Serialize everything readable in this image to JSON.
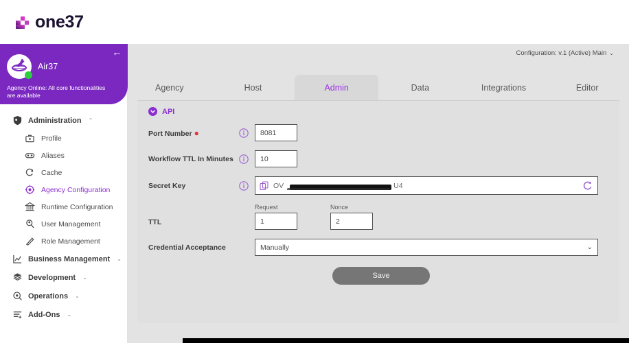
{
  "brand": {
    "name": "one37",
    "logo_icon": "one37-mark-icon"
  },
  "agency": {
    "name": "Air37",
    "status_text": "Agency Online: All core functionalities are available",
    "collapse_icon": "arrow-left-icon",
    "avatar_icon": "airplane-globe-avatar",
    "status_dot_color": "#2ECC40",
    "panel_color": "#7A28C0"
  },
  "sidebar": {
    "groups": [
      {
        "label": "Administration",
        "icon": "shield-user-icon",
        "expanded": true,
        "chevron": "⌃",
        "items": [
          {
            "label": "Profile",
            "icon": "briefcase-icon",
            "active": false
          },
          {
            "label": "Aliases",
            "icon": "goggles-icon",
            "active": false
          },
          {
            "label": "Cache",
            "icon": "refresh-cycle-icon",
            "active": false
          },
          {
            "label": "Agency Configuration",
            "icon": "gear-target-icon",
            "active": true
          },
          {
            "label": "Runtime Configuration",
            "icon": "bank-building-icon",
            "active": false
          },
          {
            "label": "User Management",
            "icon": "person-search-icon",
            "active": false
          },
          {
            "label": "Role Management",
            "icon": "pen-slash-icon",
            "active": false
          }
        ]
      },
      {
        "label": "Business Management",
        "icon": "chart-analytics-icon",
        "expanded": false,
        "chevron": "⌄",
        "items": []
      },
      {
        "label": "Development",
        "icon": "database-cube-icon",
        "expanded": false,
        "chevron": "⌄",
        "items": []
      },
      {
        "label": "Operations",
        "icon": "gear-magnifier-icon",
        "expanded": false,
        "chevron": "⌄",
        "items": []
      },
      {
        "label": "Add-Ons",
        "icon": "list-plus-icon",
        "expanded": false,
        "chevron": "⌄",
        "items": []
      }
    ]
  },
  "main": {
    "configuration_label": "Configuration: v.1 (Active) Main",
    "configuration_chevron": "⌄",
    "tabs": [
      {
        "label": "Agency",
        "active": false
      },
      {
        "label": "Host",
        "active": false
      },
      {
        "label": "Admin",
        "active": true
      },
      {
        "label": "Data",
        "active": false
      },
      {
        "label": "Integrations",
        "active": false
      },
      {
        "label": "Editor",
        "active": false
      }
    ],
    "active_tab_color": "#9B30E8",
    "section": {
      "title": "API",
      "collapse_icon": "chevron-down-circle-icon",
      "accent_color": "#8B2FD1"
    },
    "fields": {
      "port_number": {
        "label": "Port Number",
        "required": true,
        "required_marker": "●",
        "info_icon": "info-icon",
        "value": "8081"
      },
      "workflow_ttl": {
        "label": "Workflow TTL In Minutes",
        "info_icon": "info-icon",
        "value": "10"
      },
      "secret_key": {
        "label": "Secret Key",
        "info_icon": "info-icon",
        "copy_icon": "copy-icon",
        "refresh_icon": "regenerate-icon",
        "value_prefix": "OV",
        "value_suffix": "U4",
        "redacted": true
      },
      "ttl": {
        "label": "TTL",
        "request": {
          "caption": "Request",
          "value": "1"
        },
        "nonce": {
          "caption": "Nonce",
          "value": "2"
        }
      },
      "credential_acceptance": {
        "label": "Credential Acceptance",
        "value": "Manually",
        "chevron": "⌄",
        "options": [
          "Manually"
        ]
      }
    },
    "save_button": {
      "label": "Save",
      "color": "#767676"
    }
  }
}
